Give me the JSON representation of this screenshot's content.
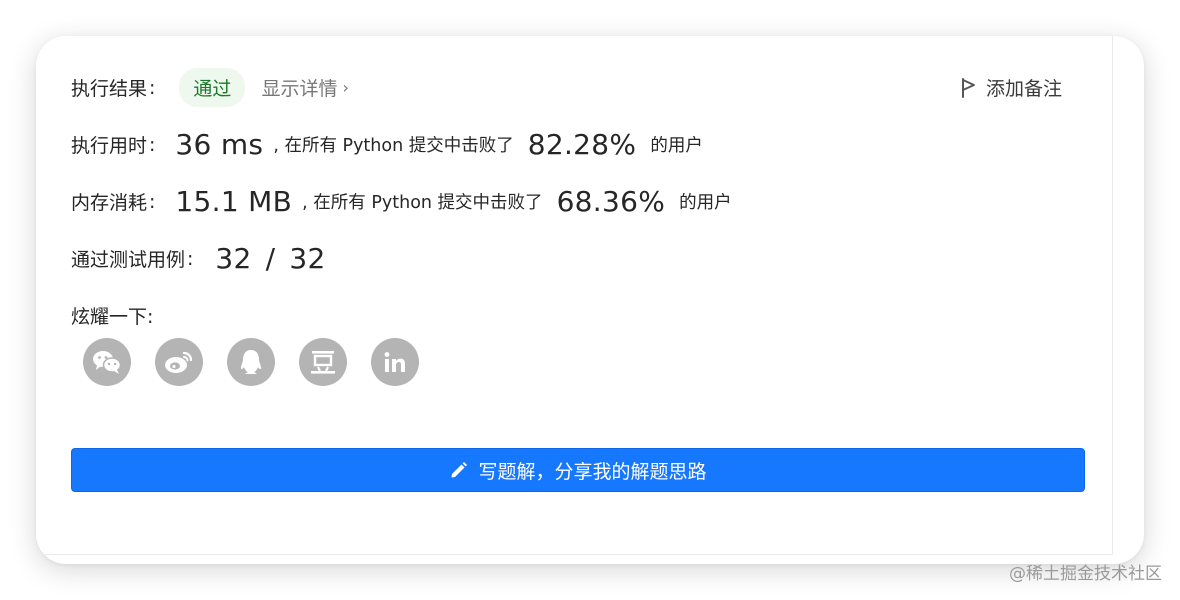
{
  "result": {
    "label": "执行结果",
    "colon": ":",
    "status": "通过",
    "details_link": "显示详情",
    "chevron": "›",
    "note_button": "添加备注"
  },
  "runtime": {
    "label": "执行用时",
    "colon": ":",
    "value": "36 ms",
    "prefix": ", 在所有 Python 提交中击败了",
    "percent": "82.28%",
    "suffix": "的用户"
  },
  "memory": {
    "label": "内存消耗",
    "colon": ":",
    "value": "15.1 MB",
    "prefix": ", 在所有 Python 提交中击败了",
    "percent": "68.36%",
    "suffix": "的用户"
  },
  "tests": {
    "label": "通过测试用例",
    "colon": ":",
    "passed": "32",
    "sep": "/",
    "total": "32"
  },
  "share": {
    "title": "炫耀一下:",
    "icons": [
      "wechat-icon",
      "weibo-icon",
      "qq-icon",
      "douban-icon",
      "linkedin-icon"
    ]
  },
  "write_button": {
    "label": "写题解，分享我的解题思路",
    "icon": "pencil-icon"
  },
  "watermark": "@稀土掘金技术社区",
  "colors": {
    "primary": "#1677ff",
    "success_bg": "#eef8ee",
    "success_text": "#1a7a2a",
    "icon_gray": "#b4b4b4"
  }
}
